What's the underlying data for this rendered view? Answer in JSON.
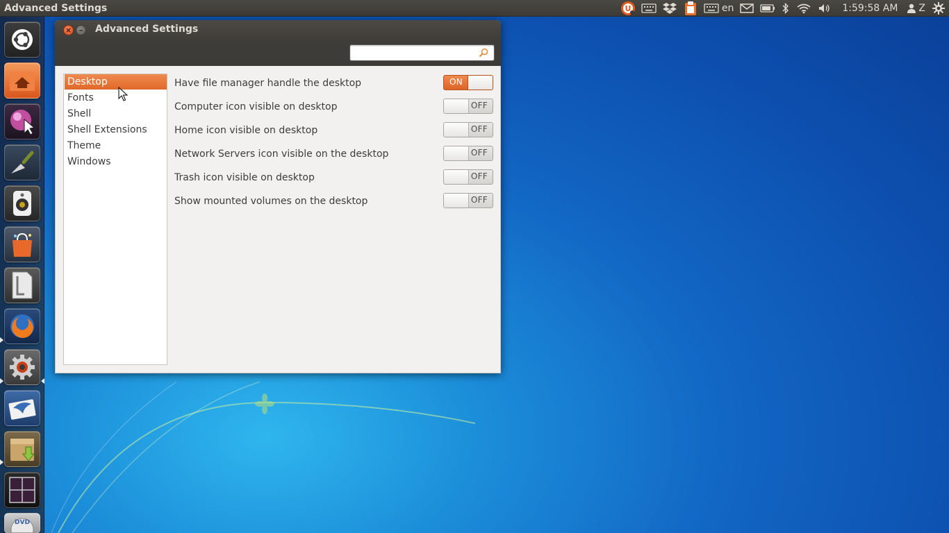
{
  "top_panel": {
    "app_title": "Advanced Settings",
    "tray": {
      "keyboard_lang": "en",
      "clock": "1:59:58 AM",
      "user": "Z"
    }
  },
  "launcher": {
    "items": [
      {
        "name": "ubuntu-dash"
      },
      {
        "name": "home-folder"
      },
      {
        "name": "pointer-app"
      },
      {
        "name": "trowel-app"
      },
      {
        "name": "speaker-app"
      },
      {
        "name": "software-center"
      },
      {
        "name": "document-viewer"
      },
      {
        "name": "firefox"
      },
      {
        "name": "system-settings"
      },
      {
        "name": "mail-app"
      },
      {
        "name": "archive-installer"
      },
      {
        "name": "workspace-switcher"
      },
      {
        "name": "dvd-drive"
      }
    ]
  },
  "window": {
    "title": "Advanced Settings",
    "search": {
      "value": "",
      "placeholder": ""
    },
    "sidebar": [
      {
        "label": "Desktop",
        "selected": true
      },
      {
        "label": "Fonts"
      },
      {
        "label": "Shell"
      },
      {
        "label": "Shell Extensions"
      },
      {
        "label": "Theme"
      },
      {
        "label": "Windows"
      }
    ],
    "settings": [
      {
        "label": "Have file manager handle the desktop",
        "state": "ON"
      },
      {
        "label": "Computer icon visible on desktop",
        "state": "OFF"
      },
      {
        "label": "Home icon visible on desktop",
        "state": "OFF"
      },
      {
        "label": "Network Servers icon visible on the desktop",
        "state": "OFF"
      },
      {
        "label": "Trash icon visible on desktop",
        "state": "OFF"
      },
      {
        "label": "Show mounted volumes on the desktop",
        "state": "OFF"
      }
    ]
  },
  "colors": {
    "accent": "#e06829",
    "panel": "#3c3b37",
    "window_bg": "#f2f1f0"
  }
}
